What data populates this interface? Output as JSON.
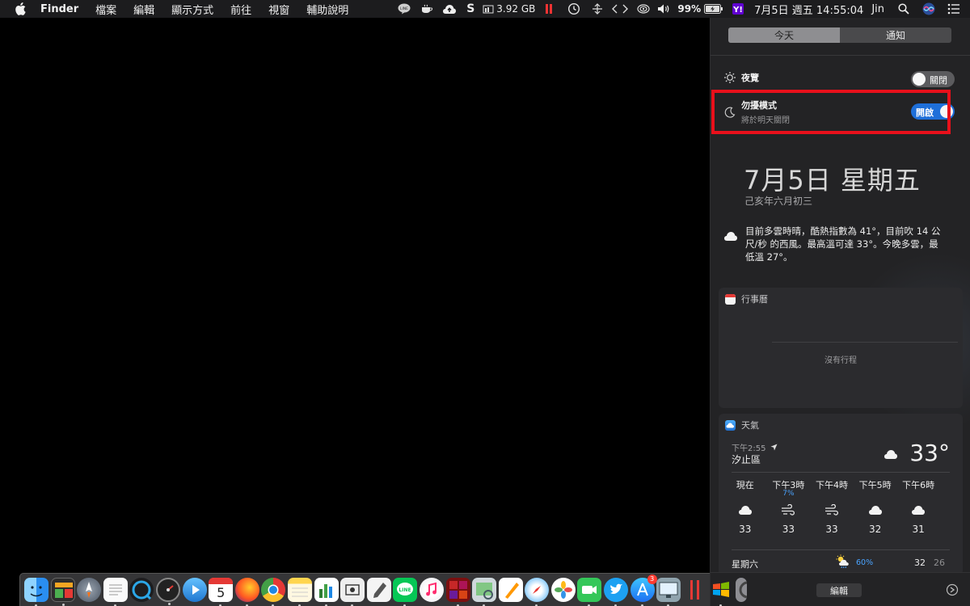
{
  "menubar": {
    "apple_icon": "apple-logo",
    "app_name": "Finder",
    "menus": [
      "檔案",
      "編輯",
      "顯示方式",
      "前往",
      "視窗",
      "輔助說明"
    ],
    "status": {
      "memory": "3.92 GB",
      "battery": "99%",
      "datetime": "7月5日 週五  14:55:04",
      "user": "Jin"
    }
  },
  "notification_center": {
    "tabs": [
      {
        "label": "今天",
        "active": true
      },
      {
        "label": "通知",
        "active": false
      }
    ],
    "night_shift": {
      "label": "夜覽",
      "state": "關閉"
    },
    "dnd": {
      "label": "勿擾模式",
      "sublabel": "將於明天關閉",
      "state": "開啟"
    },
    "date": "7月5日  星期五",
    "lunar": "己亥年六月初三",
    "summary": "目前多雲時晴，酷熱指數為 41°，目前吹 14 公尺/秒 的西風。最高溫可達 33°。今晚多雲，最低溫 27°。",
    "calendar": {
      "title": "行事曆",
      "empty": "沒有行程"
    },
    "weather": {
      "title": "天氣",
      "time": "下午2:55",
      "location": "汐止區",
      "current_temp": "33°",
      "hourly": [
        {
          "label": "現在",
          "pct": "",
          "icon": "cloud-icon",
          "temp": "33"
        },
        {
          "label": "下午3時",
          "pct": "7%",
          "icon": "wind-icon",
          "temp": "33"
        },
        {
          "label": "下午4時",
          "pct": "",
          "icon": "wind-icon",
          "temp": "33"
        },
        {
          "label": "下午5時",
          "pct": "",
          "icon": "cloud-icon",
          "temp": "32"
        },
        {
          "label": "下午6時",
          "pct": "",
          "icon": "cloud-icon",
          "temp": "31"
        }
      ],
      "daily": [
        {
          "day": "星期六",
          "pct": "60%",
          "hi": "32",
          "lo": "26"
        }
      ]
    },
    "edit_label": "編輯"
  },
  "dock": {
    "apps": [
      "finder",
      "task-manager",
      "launchpad",
      "text-edit",
      "quicktime-search",
      "dashboard",
      "quicktime-player",
      "calendar",
      "firefox",
      "chrome",
      "notes",
      "numbers",
      "screenshot",
      "textedit-2",
      "line",
      "itunes",
      "photo-booth",
      "preview",
      "pages",
      "safari",
      "photos",
      "facetime",
      "twitter",
      "app-store",
      "system-preferences-display",
      "parallels",
      "system-preferences"
    ],
    "calendar_day": "5",
    "app_store_badge": "3"
  }
}
